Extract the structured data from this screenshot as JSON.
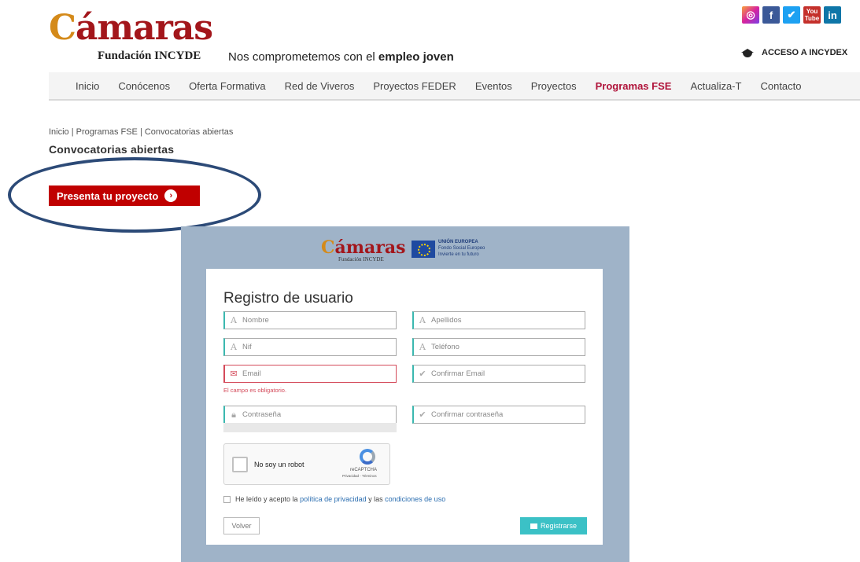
{
  "header": {
    "logo_prefix": "C",
    "logo_rest": "ámaras",
    "logo_sub": "Fundación INCYDE",
    "tagline_start": "Nos comprometemos con el ",
    "tagline_bold": "empleo joven",
    "acceso": "ACCESO A INCYDEX",
    "social": [
      "instagram",
      "facebook",
      "twitter",
      "youtube",
      "linkedin"
    ]
  },
  "nav": {
    "items": [
      "Inicio",
      "Conócenos",
      "Oferta Formativa",
      "Red de Viveros",
      "Proyectos FEDER",
      "Eventos",
      "Proyectos",
      "Programas FSE",
      "Actualiza-T",
      "Contacto"
    ],
    "active": "Programas FSE"
  },
  "breadcrumb": "Inicio | Programas FSE | Convocatorias abiertas",
  "page_title": "Convocatorias abiertas",
  "presenta_button": "Presenta tu proyecto",
  "form": {
    "logo_prefix": "C",
    "logo_rest": "ámaras",
    "logo_sub": "Fundación INCYDE",
    "eu_title": "UNIÓN EUROPEA",
    "eu_line2": "Fondo Social Europeo",
    "eu_line3": "Invierte en tu futuro",
    "title": "Registro de usuario",
    "fields": {
      "nombre": "Nombre",
      "apellidos": "Apellidos",
      "nif": "Nif",
      "telefono": "Teléfono",
      "email": "Email",
      "confirmar_email": "Confirmar Email",
      "contrasena": "Contraseña",
      "confirmar_contrasena": "Confirmar contraseña"
    },
    "error_message": "El campo es obligatorio.",
    "captcha": {
      "label": "No soy un robot",
      "brand": "reCAPTCHA",
      "links": "Privacidad - Términos"
    },
    "terms": {
      "text1": "He leído y acepto la ",
      "link1": "política de privacidad",
      "text2": " y las ",
      "link2": "condiciones de uso"
    },
    "volver": "Volver",
    "registrarse": "Registrarse"
  },
  "colors": {
    "brand_red": "#a3161b",
    "active_nav": "#b0133a",
    "button_red": "#c00000",
    "teal": "#3bc1c6",
    "error": "#d44a5a",
    "annotation": "#2c4a77"
  }
}
